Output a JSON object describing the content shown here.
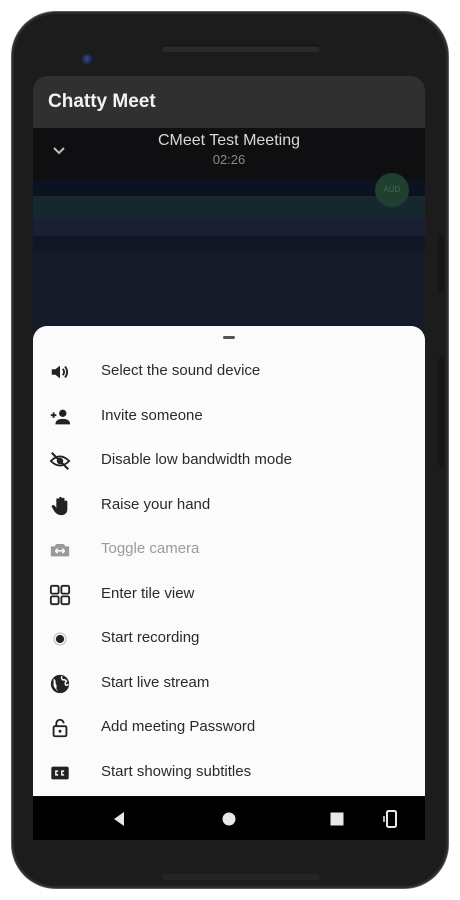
{
  "app": {
    "title": "Chatty Meet"
  },
  "meeting": {
    "title": "CMeet Test Meeting",
    "elapsed": "02:26",
    "participant_initials": "AUD"
  },
  "menu": {
    "items": [
      {
        "label": "Select the sound device",
        "icon": "volume-icon",
        "enabled": true
      },
      {
        "label": "Invite someone",
        "icon": "person-add-icon",
        "enabled": true
      },
      {
        "label": "Disable low bandwidth mode",
        "icon": "eye-off-icon",
        "enabled": true
      },
      {
        "label": "Raise your hand",
        "icon": "hand-icon",
        "enabled": true
      },
      {
        "label": "Toggle camera",
        "icon": "switch-camera-icon",
        "enabled": false
      },
      {
        "label": "Enter tile view",
        "icon": "tile-view-icon",
        "enabled": true
      },
      {
        "label": "Start recording",
        "icon": "record-icon",
        "enabled": true
      },
      {
        "label": "Start live stream",
        "icon": "globe-icon",
        "enabled": true
      },
      {
        "label": "Add meeting Password",
        "icon": "lock-open-icon",
        "enabled": true
      },
      {
        "label": "Start showing subtitles",
        "icon": "closed-caption-icon",
        "enabled": true
      }
    ]
  },
  "navbar": {
    "buttons": [
      "back-icon",
      "home-icon",
      "recents-icon",
      "rotate-icon"
    ]
  },
  "colors": {
    "app_bar": "#303030",
    "sheet_background": "#fbfbfb",
    "menu_text": "#2a2a2a",
    "disabled_text": "#9a9a9a",
    "video_background": "#151a28"
  }
}
